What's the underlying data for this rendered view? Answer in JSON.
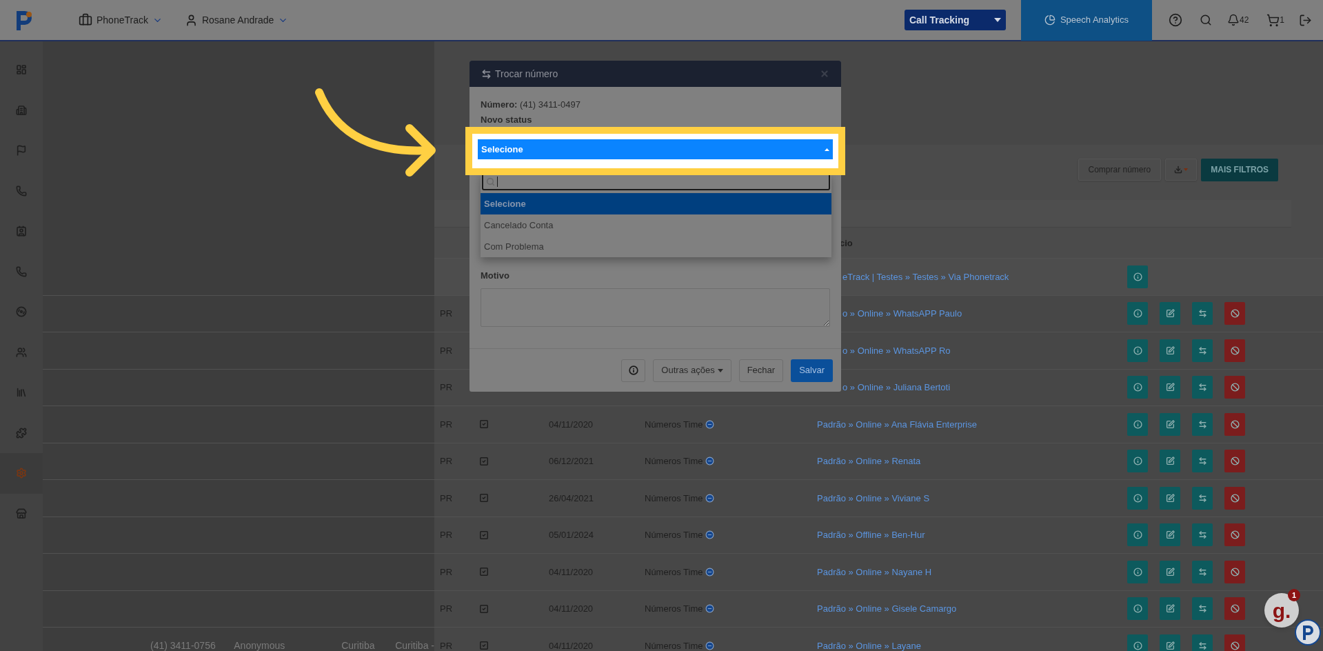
{
  "header": {
    "brand_menu": "PhoneTrack",
    "user_menu": "Rosane Andrade",
    "product_select": "Call Tracking",
    "speech_analytics": "Speech Analytics",
    "notifications_count": "42",
    "cart_count": "1"
  },
  "sidebar": {
    "items": [
      {
        "kind": "dashboard",
        "selected": false
      },
      {
        "kind": "building",
        "selected": false
      },
      {
        "kind": "flag",
        "selected": false
      },
      {
        "kind": "phone",
        "selected": false
      },
      {
        "kind": "contact",
        "selected": false
      },
      {
        "kind": "phone",
        "selected": false
      },
      {
        "kind": "audio",
        "selected": false
      },
      {
        "kind": "people",
        "selected": false
      },
      {
        "kind": "library",
        "selected": false
      },
      {
        "kind": "puzzle",
        "selected": false
      },
      {
        "kind": "settings",
        "selected": true
      },
      {
        "kind": "store",
        "selected": false
      }
    ]
  },
  "toolbar": {
    "buy_button": "Comprar número",
    "filters_button": "MAIS FILTROS"
  },
  "table": {
    "visible_heading": "cio",
    "rows": [
      {
        "path": "eTrack | Testes » Testes » Via Phonetrack",
        "clipped": true,
        "actions": [
          {
            "kind": "info"
          }
        ]
      },
      {
        "state": "PR",
        "path": "o » Online » WhatsAPP Paulo",
        "clipped": true,
        "actions": [
          {
            "kind": "info"
          },
          {
            "kind": "edit"
          },
          {
            "kind": "swap"
          },
          {
            "kind": "block"
          }
        ]
      },
      {
        "state": "PR",
        "path": "o » Online » WhatsAPP Ro",
        "clipped": true,
        "actions": [
          {
            "kind": "info"
          },
          {
            "kind": "edit"
          },
          {
            "kind": "swap"
          },
          {
            "kind": "block"
          }
        ]
      },
      {
        "state": "PR",
        "path": "o » Online » Juliana Bertoti",
        "clipped": true,
        "actions": [
          {
            "kind": "info"
          },
          {
            "kind": "edit"
          },
          {
            "kind": "swap"
          },
          {
            "kind": "block"
          }
        ]
      },
      {
        "state": "PR",
        "checked": true,
        "date": "04/11/2020",
        "team": "Números Time",
        "path": "Padrão » Online » Ana Flávia Enterprise",
        "actions": [
          {
            "kind": "info"
          },
          {
            "kind": "edit"
          },
          {
            "kind": "swap"
          },
          {
            "kind": "block"
          }
        ]
      },
      {
        "state": "PR",
        "checked": true,
        "date": "06/12/2021",
        "team": "Números Time",
        "path": "Padrão » Online » Renata",
        "actions": [
          {
            "kind": "info"
          },
          {
            "kind": "edit"
          },
          {
            "kind": "swap"
          },
          {
            "kind": "block"
          }
        ]
      },
      {
        "state": "PR",
        "checked": true,
        "date": "26/04/2021",
        "team": "Números Time",
        "path": "Padrão » Online » Viviane S",
        "actions": [
          {
            "kind": "info"
          },
          {
            "kind": "edit"
          },
          {
            "kind": "swap"
          },
          {
            "kind": "block"
          }
        ]
      },
      {
        "state": "PR",
        "checked": true,
        "date": "05/01/2024",
        "team": "Números Time",
        "path": "Padrão » Offline » Ben-Hur",
        "actions": [
          {
            "kind": "info"
          },
          {
            "kind": "edit"
          },
          {
            "kind": "swap"
          },
          {
            "kind": "block"
          }
        ]
      },
      {
        "state": "PR",
        "checked": true,
        "date": "04/11/2020",
        "team": "Números Time",
        "path": "Padrão » Online » Nayane H",
        "actions": [
          {
            "kind": "info"
          },
          {
            "kind": "edit"
          },
          {
            "kind": "swap"
          },
          {
            "kind": "block"
          }
        ]
      },
      {
        "state": "PR",
        "checked": true,
        "date": "04/11/2020",
        "team": "Números Time",
        "path": "Padrão » Online » Gisele Camargo",
        "actions": [
          {
            "kind": "info"
          },
          {
            "kind": "edit"
          },
          {
            "kind": "swap"
          },
          {
            "kind": "block"
          }
        ]
      },
      {
        "number": "(41) 3411-0756",
        "name": "Anonymous",
        "city": "Curitiba",
        "region": "Curitiba -",
        "state": "PR",
        "checked": true,
        "date": "04/11/2020",
        "team": "Números Time",
        "path": "Padrão » Online » Layane",
        "actions": [
          {
            "kind": "info"
          },
          {
            "kind": "edit"
          },
          {
            "kind": "swap"
          },
          {
            "kind": "block"
          }
        ]
      }
    ]
  },
  "modal": {
    "title": "Trocar número",
    "number_label": "Número:",
    "number_value": "(41) 3411-0497",
    "status_label": "Novo status",
    "select_value": "Selecione",
    "options": [
      {
        "label": "Selecione",
        "selected": true
      },
      {
        "label": "Cancelado Conta",
        "selected": false
      },
      {
        "label": "Com Problema",
        "selected": false
      }
    ],
    "reason_label": "Motivo",
    "buttons": {
      "other": "Outras ações",
      "close": "Fechar",
      "save": "Salvar"
    }
  },
  "chat": {
    "logo": "g.",
    "badge": "1"
  }
}
